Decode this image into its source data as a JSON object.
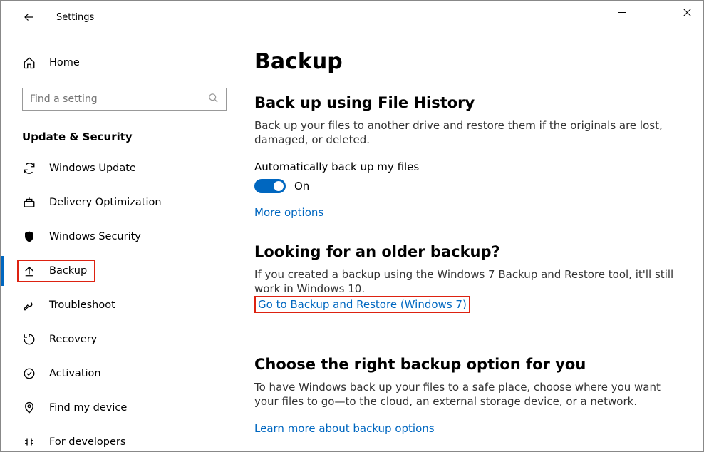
{
  "window": {
    "title": "Settings"
  },
  "sidebar": {
    "home": "Home",
    "search_placeholder": "Find a setting",
    "section": "Update & Security",
    "items": [
      {
        "label": "Windows Update"
      },
      {
        "label": "Delivery Optimization"
      },
      {
        "label": "Windows Security"
      },
      {
        "label": "Backup"
      },
      {
        "label": "Troubleshoot"
      },
      {
        "label": "Recovery"
      },
      {
        "label": "Activation"
      },
      {
        "label": "Find my device"
      },
      {
        "label": "For developers"
      }
    ]
  },
  "main": {
    "title": "Backup",
    "file_history": {
      "heading": "Back up using File History",
      "body": "Back up your files to another drive and restore them if the originals are lost, damaged, or deleted.",
      "toggle_label": "Automatically back up my files",
      "toggle_state": "On",
      "more_options": "More options"
    },
    "older": {
      "heading": "Looking for an older backup?",
      "body": "If you created a backup using the Windows 7 Backup and Restore tool, it'll still work in Windows 10.",
      "link": "Go to Backup and Restore (Windows 7)"
    },
    "choose": {
      "heading": "Choose the right backup option for you",
      "body": "To have Windows back up your files to a safe place, choose where you want your files to go—to the cloud, an external storage device, or a network.",
      "link": "Learn more about backup options"
    }
  }
}
